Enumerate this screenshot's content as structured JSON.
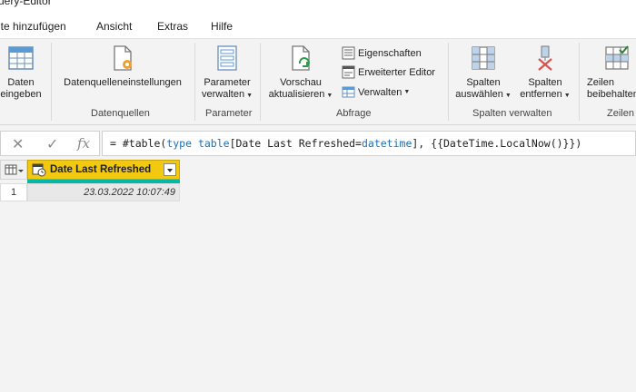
{
  "window": {
    "title": "uery-Editor"
  },
  "menu": [
    "lte hinzufügen",
    "Ansicht",
    "Extras",
    "Hilfe"
  ],
  "ribbon": {
    "btn_daten": [
      "Daten",
      "eingeben"
    ],
    "btn_datenquellen": "Datenquelleneinstellungen",
    "btn_parameter": [
      "Parameter",
      "verwalten"
    ],
    "btn_vorschau": [
      "Vorschau",
      "aktualisieren"
    ],
    "small_eigenschaften": "Eigenschaften",
    "small_editor": "Erweiterter Editor",
    "small_verwalten": "Verwalten",
    "btn_spalten_auswaehlen": [
      "Spalten",
      "auswählen"
    ],
    "btn_spalten_entfernen": [
      "Spalten",
      "entfernen"
    ],
    "btn_zeilen": [
      "Zeilen",
      "beibehalten"
    ],
    "group_datenquellen": "Datenquellen",
    "group_parameter": "Parameter",
    "group_abfrage": "Abfrage",
    "group_spalten": "Spalten verwalten",
    "group_zeilen": "Zeilen"
  },
  "formula": {
    "prefix": "= #table(",
    "kw_type": "type",
    "kw_table": "table",
    "middle": "[Date Last Refreshed=",
    "kw_datetime": "datetime",
    "suffix": "], {{DateTime.LocalNow()}})"
  },
  "grid": {
    "column_header": "Date Last Refreshed",
    "row_number": "1",
    "cell_value": "23.03.2022 10:07:49"
  },
  "colors": {
    "column_header": "#f2c811",
    "quality_bar": "#01b8aa",
    "keyword": "#1f6fb2"
  }
}
